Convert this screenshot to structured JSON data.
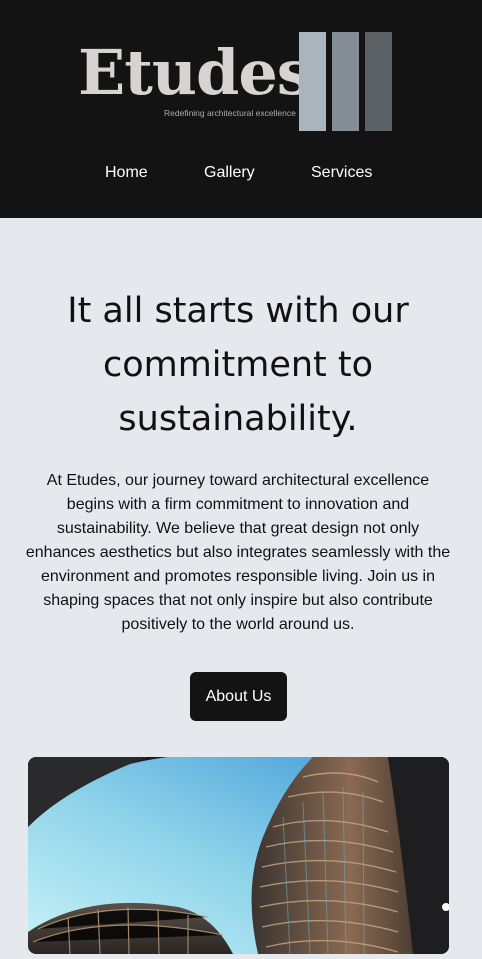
{
  "header": {
    "logo": {
      "wordmark": "Etudes",
      "tagline": "Redefining architectural excellence"
    },
    "nav": [
      {
        "label": "Home"
      },
      {
        "label": "Gallery"
      },
      {
        "label": "Services"
      }
    ]
  },
  "main": {
    "headline": "It all starts with our commitment to sustainability.",
    "body": "At Etudes, our journey toward architectural excellence begins with a firm commitment to innovation and sustainability. We believe that great design not only enhances aesthetics but also integrates seamlessly with the environment and promotes responsible living. Join us in shaping spaces that not only inspire but also contribute positively to the world around us.",
    "cta_label": "About Us"
  },
  "colors": {
    "header_bg": "#131313",
    "page_bg": "#e5e9ed",
    "button_bg": "#131313",
    "logo_bar_1": "#a9b4bd",
    "logo_bar_2": "#858d97",
    "logo_bar_3": "#5b6165"
  }
}
